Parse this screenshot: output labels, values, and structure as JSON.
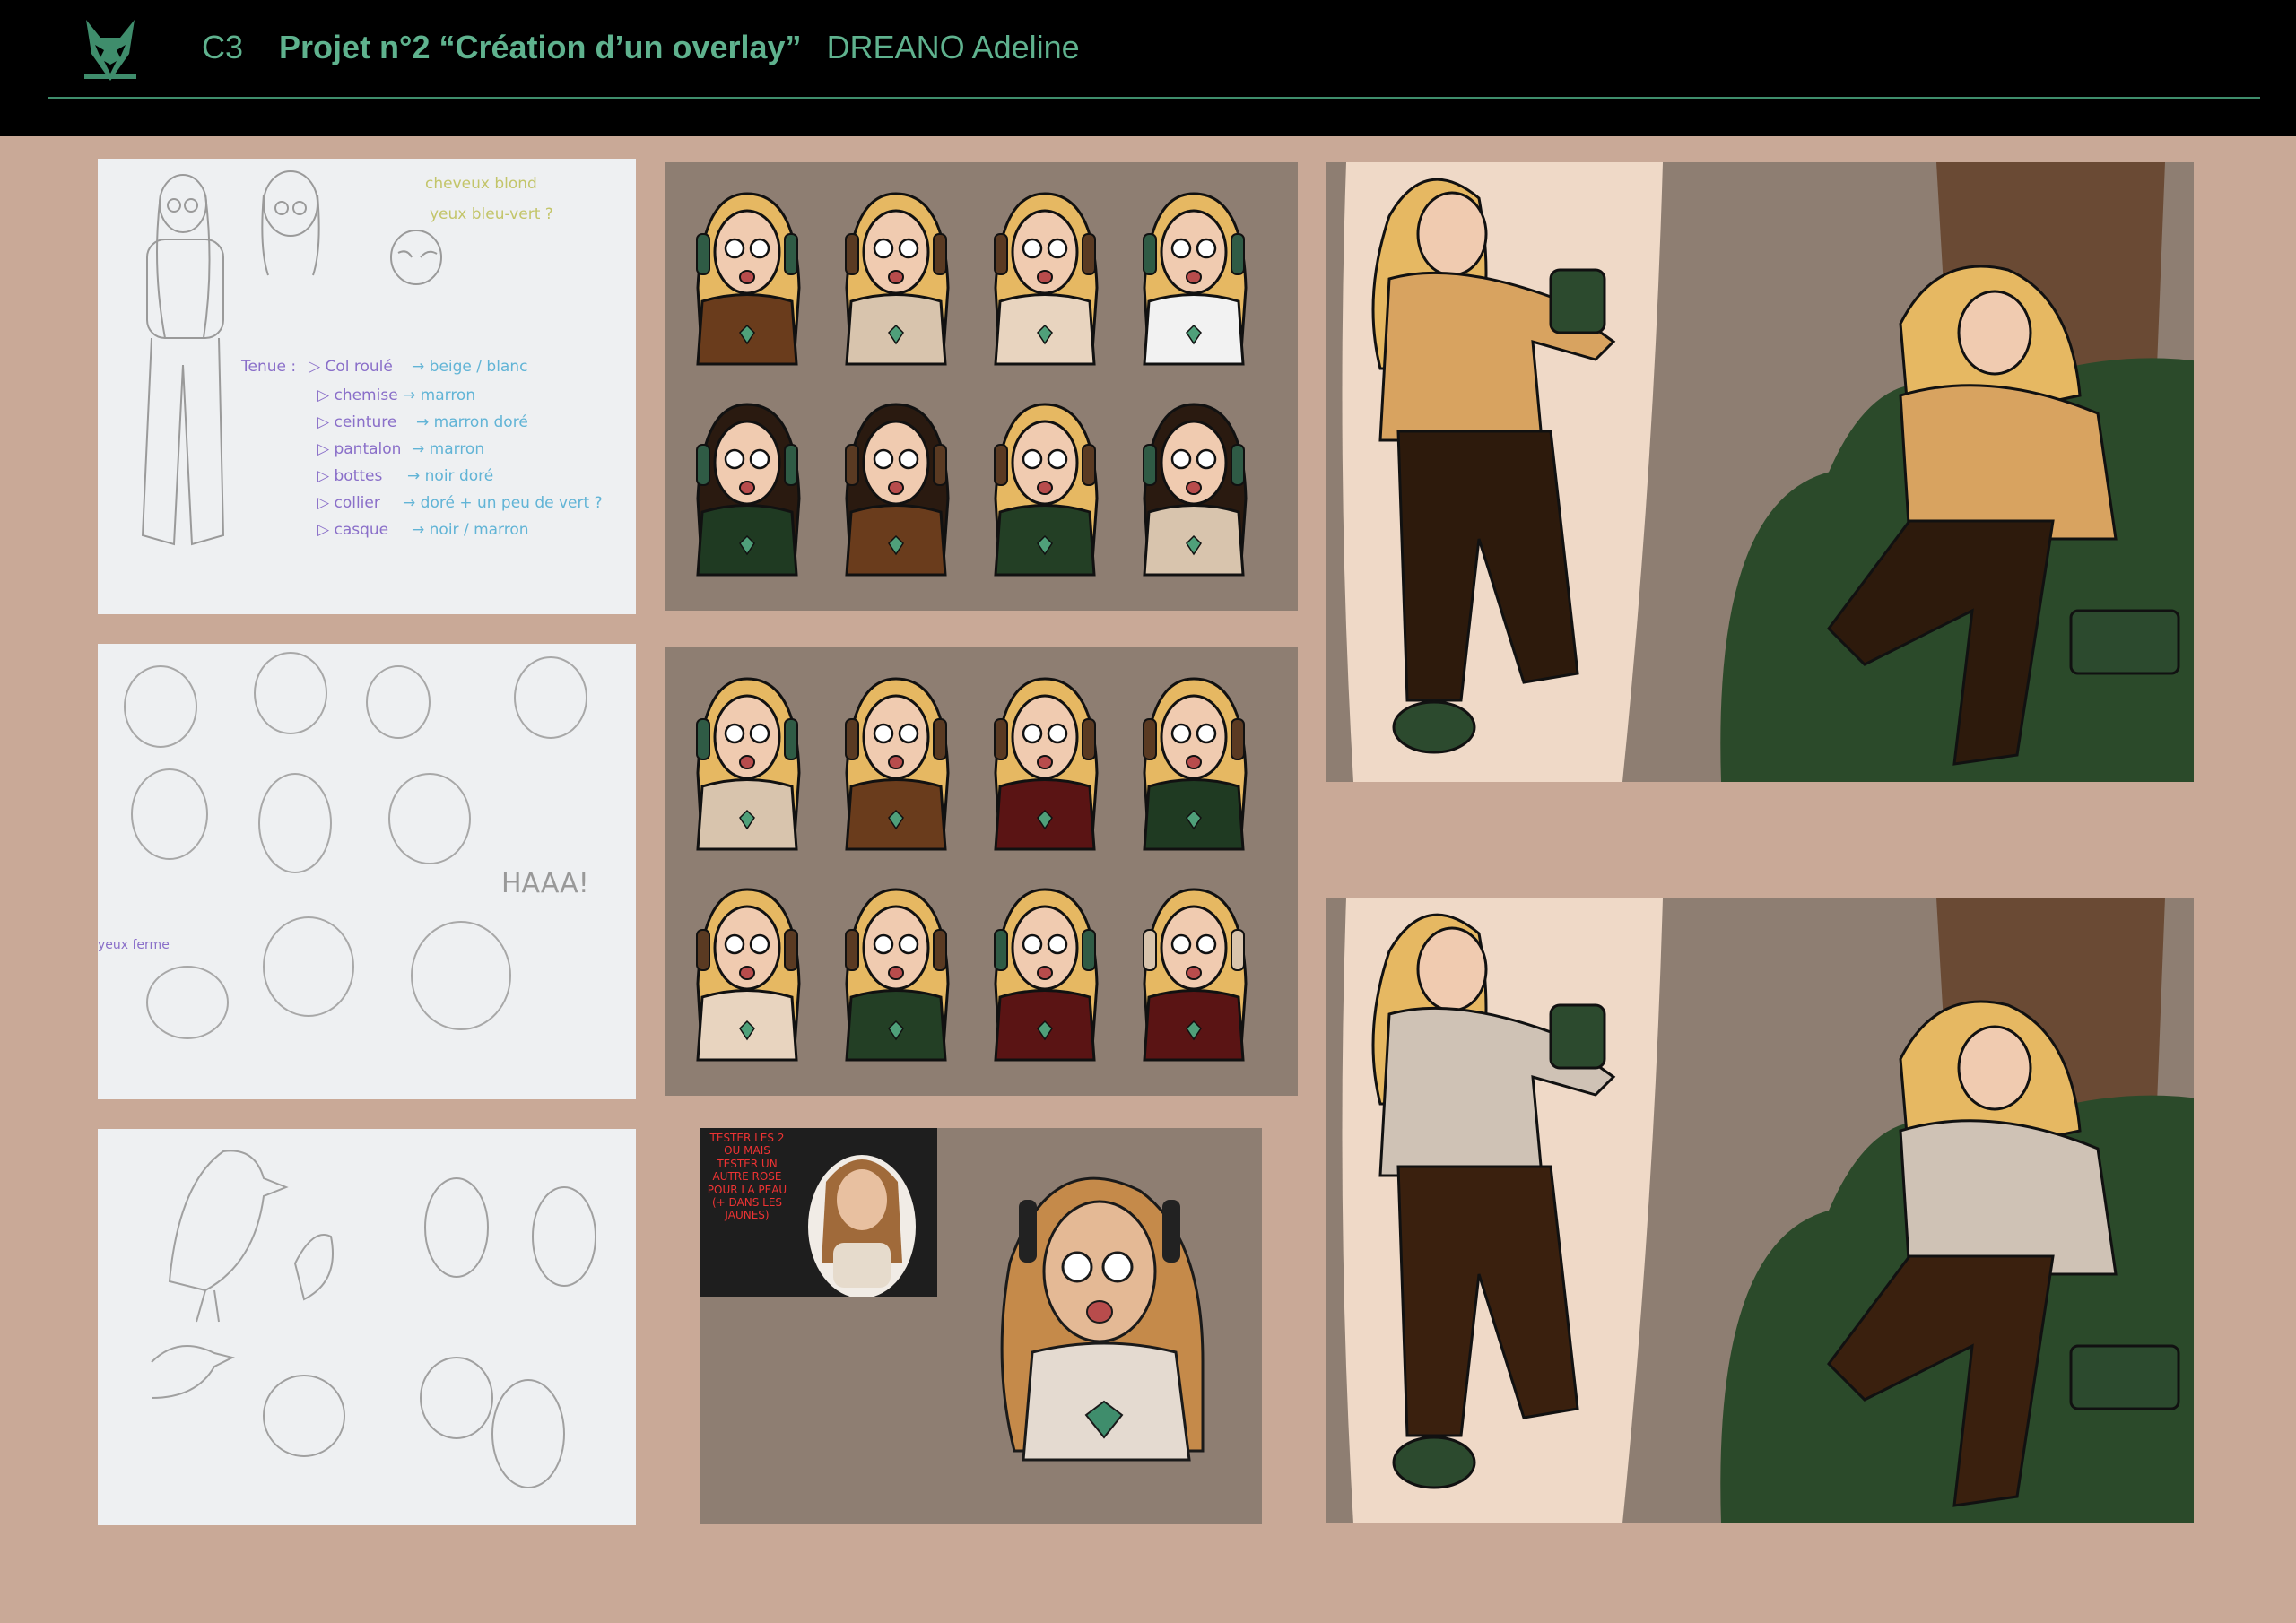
{
  "header": {
    "course_code": "C3",
    "project_title": "Projet n°2  “Création d’un overlay”",
    "author": "DREANO Adeline"
  },
  "colors": {
    "accent_green": "#5fb28e",
    "background": "#c9a997",
    "panel_grey": "#8e7e72"
  },
  "sketch_notes": {
    "hair": "cheveux blond",
    "eyes": "yeux bleu-vert ?",
    "outfit_heading": "Tenue :",
    "items": [
      {
        "item": "▷ Col roulé",
        "color": "→ beige / blanc"
      },
      {
        "item": "▷ chemise",
        "color": "→ marron"
      },
      {
        "item": "▷ ceinture",
        "color": "→ marron doré"
      },
      {
        "item": "▷ pantalon",
        "color": "→ marron"
      },
      {
        "item": "▷ bottes",
        "color": "→ noir doré"
      },
      {
        "item": "▷ collier",
        "color": "→ doré + un peu de vert ?"
      },
      {
        "item": "▷ casque",
        "color": "→ noir / marron"
      }
    ]
  },
  "expression_sheet": {
    "shout": "HAAA!",
    "side_note": "yeux ferme"
  },
  "skin_test_note": "TESTER LES 2 OU MAIS TESTER UN AUTRE ROSE POUR LA PEAU (+ DANS LES JAUNES)",
  "variants_row1": [
    {
      "hair": "#e6b862",
      "sweater": "#6a3c1c",
      "headphones": "#2f5b45"
    },
    {
      "hair": "#e6b862",
      "sweater": "#d8c4ad",
      "headphones": "#5a3a22"
    },
    {
      "hair": "#e6b862",
      "sweater": "#e8d4bf",
      "headphones": "#5a3a22"
    },
    {
      "hair": "#e6b862",
      "sweater": "#f2f2f2",
      "headphones": "#2f5b45"
    },
    {
      "hair": "#2a1a10",
      "sweater": "#1f3a22",
      "headphones": "#2f5b45"
    },
    {
      "hair": "#2a1a10",
      "sweater": "#6a3c1c",
      "headphones": "#5a3a22"
    },
    {
      "hair": "#e6b862",
      "sweater": "#233f25",
      "headphones": "#5a3a22"
    },
    {
      "hair": "#2a1a10",
      "sweater": "#d8c4ad",
      "headphones": "#2f5b45"
    }
  ],
  "variants_row2": [
    {
      "hair": "#e6b862",
      "sweater": "#d8c4ad",
      "headphones": "#2f5b45"
    },
    {
      "hair": "#e6b862",
      "sweater": "#6a3c1c",
      "headphones": "#5a3a22"
    },
    {
      "hair": "#e6b862",
      "sweater": "#5a1414",
      "headphones": "#5a3a22"
    },
    {
      "hair": "#e6b862",
      "sweater": "#1f3a22",
      "headphones": "#5a3a22"
    },
    {
      "hair": "#e6b862",
      "sweater": "#e8d4bf",
      "headphones": "#5a3a22"
    },
    {
      "hair": "#e6b862",
      "sweater": "#233f25",
      "headphones": "#5a3a22"
    },
    {
      "hair": "#e6b862",
      "sweater": "#5a1414",
      "headphones": "#2f5b45"
    },
    {
      "hair": "#e6b862",
      "sweater": "#5a1414",
      "headphones": "#d8c4ad"
    }
  ],
  "scenes": [
    {
      "sweater": "#d8a360",
      "pants": "#2d1a0c"
    },
    {
      "sweater": "#cfc2b5",
      "pants": "#3a200e"
    }
  ]
}
